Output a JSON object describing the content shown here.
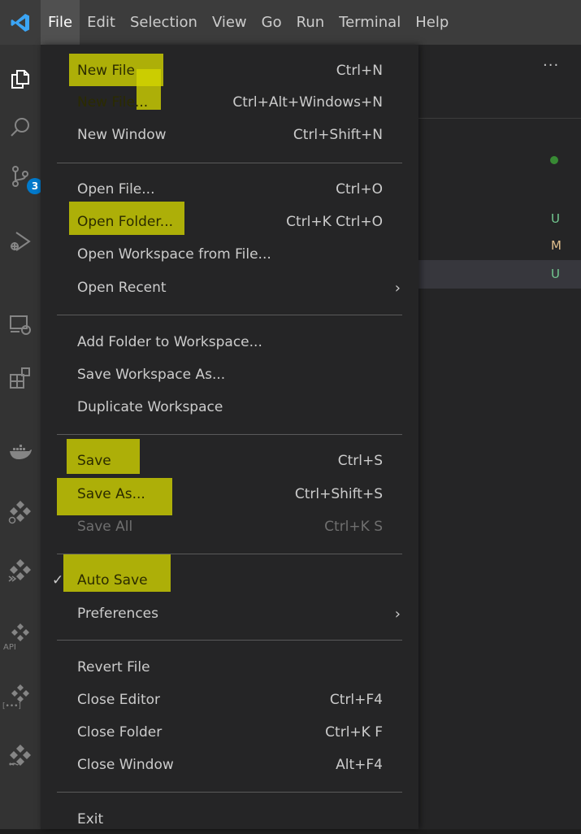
{
  "menubar": {
    "items": [
      "File",
      "Edit",
      "Selection",
      "View",
      "Go",
      "Run",
      "Terminal",
      "Help"
    ],
    "active": "File"
  },
  "activity": {
    "source_control_badge": "3",
    "api_label": "API",
    "brackets_label": "[•••]"
  },
  "sidebar": {
    "more": "···",
    "status_u1": "U",
    "status_m": "M",
    "status_u2": "U"
  },
  "file_menu": {
    "items": [
      {
        "label": "New File",
        "shortcut": "Ctrl+N"
      },
      {
        "label": "New File...",
        "shortcut": "Ctrl+Alt+Windows+N"
      },
      {
        "label": "New Window",
        "shortcut": "Ctrl+Shift+N"
      },
      {
        "label": "Open File...",
        "shortcut": "Ctrl+O"
      },
      {
        "label": "Open Folder...",
        "shortcut": "Ctrl+K Ctrl+O"
      },
      {
        "label": "Open Workspace from File...",
        "shortcut": ""
      },
      {
        "label": "Open Recent",
        "shortcut": ""
      },
      {
        "label": "Add Folder to Workspace...",
        "shortcut": ""
      },
      {
        "label": "Save Workspace As...",
        "shortcut": ""
      },
      {
        "label": "Duplicate Workspace",
        "shortcut": ""
      },
      {
        "label": "Save",
        "shortcut": "Ctrl+S"
      },
      {
        "label": "Save As...",
        "shortcut": "Ctrl+Shift+S"
      },
      {
        "label": "Save All",
        "shortcut": "Ctrl+K S"
      },
      {
        "label": "Auto Save",
        "shortcut": ""
      },
      {
        "label": "Preferences",
        "shortcut": ""
      },
      {
        "label": "Revert File",
        "shortcut": ""
      },
      {
        "label": "Close Editor",
        "shortcut": "Ctrl+F4"
      },
      {
        "label": "Close Folder",
        "shortcut": "Ctrl+K F"
      },
      {
        "label": "Close Window",
        "shortcut": "Alt+F4"
      },
      {
        "label": "Exit",
        "shortcut": ""
      }
    ],
    "auto_save_checked": true,
    "submenu_arrow": "›",
    "check_mark": "✓"
  },
  "colors": {
    "menubar": "#3c3c3c",
    "menu_bg": "#252526",
    "highlight": "#d4d600",
    "git_untracked": "#73c991",
    "git_modified": "#e2c08d",
    "badge": "#007acc"
  }
}
